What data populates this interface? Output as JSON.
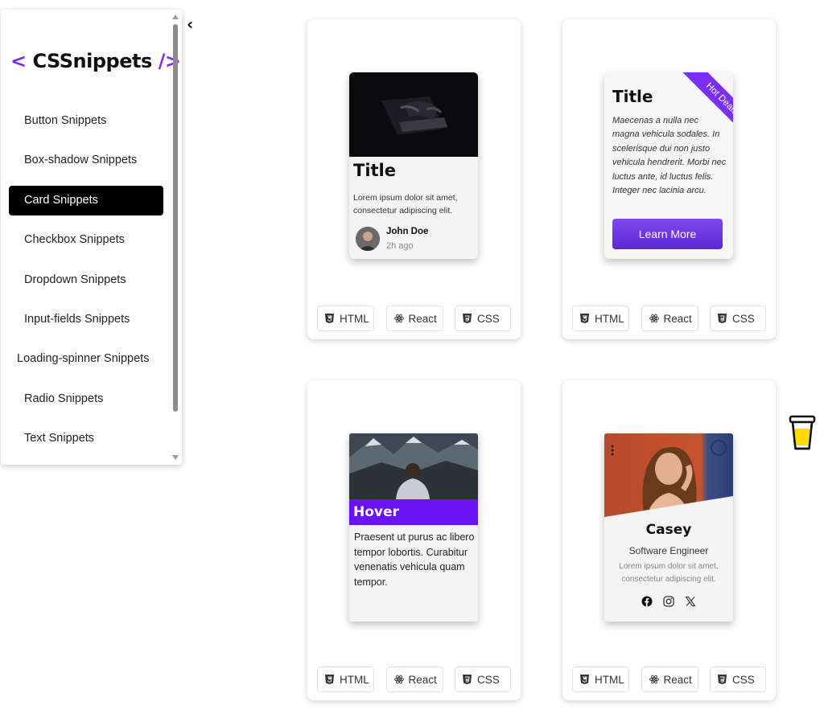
{
  "sidebar": {
    "brand": {
      "open": "<",
      "name": "CSSnippets",
      "close": "/>"
    },
    "items": [
      {
        "label": "Button Snippets",
        "active": false
      },
      {
        "label": "Box-shadow Snippets",
        "active": false
      },
      {
        "label": "Card Snippets",
        "active": true
      },
      {
        "label": "Checkbox Snippets",
        "active": false
      },
      {
        "label": "Dropdown Snippets",
        "active": false
      },
      {
        "label": "Input-fields Snippets",
        "active": false
      },
      {
        "label": "Loading-spinner Snippets",
        "active": false
      },
      {
        "label": "Radio Snippets",
        "active": false
      },
      {
        "label": "Text Snippets",
        "active": false
      }
    ],
    "collapse_icon": "chevron-left-icon"
  },
  "code_buttons": {
    "html": "HTML",
    "react": "React",
    "css": "CSS"
  },
  "cards": {
    "profile": {
      "title": "Title",
      "text": "Lorem ipsum dolor sit amet, consectetur adipiscing elit.",
      "author": "John Doe",
      "time": "2h ago"
    },
    "ribbon": {
      "title": "Title",
      "ribbon": "Hot Deals",
      "text": "Maecenas a nulla nec magna vehicula sodales. In scelerisque dui non justo vehicula hendrerit. Morbi nec luctus ante, id luctus felis. Integer nec lacinia arcu.",
      "button": "Learn More"
    },
    "hover": {
      "title": "Hover",
      "text": "Praesent ut purus ac libero tempor lobortis. Curabitur venenatis vehicula quam tempor."
    },
    "person": {
      "name": "Casey",
      "role": "Software Engineer",
      "text": "Lorem ipsum dolor sit amet, consectetur adipiscing elit.",
      "socials": [
        "facebook-icon",
        "instagram-icon",
        "x-icon"
      ]
    }
  },
  "colors": {
    "accent": "#7b2ff7",
    "hover_bar": "#6c13f5",
    "active_nav": "#000000"
  }
}
